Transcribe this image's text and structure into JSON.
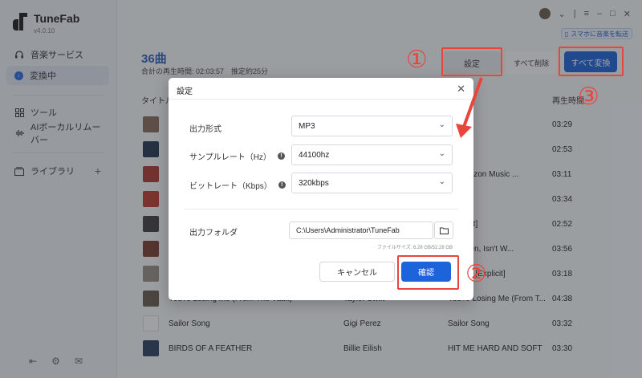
{
  "app": {
    "name": "TuneFab",
    "version": "v4.0.10"
  },
  "sidebar": {
    "items": [
      {
        "label": "音楽サービス",
        "icon": "headphones-icon"
      },
      {
        "label": "変換中",
        "icon": "download-icon"
      },
      {
        "label": "ツール",
        "icon": "grid-icon"
      },
      {
        "label": "AIボーカルリムーバー",
        "icon": "waveform-icon"
      },
      {
        "label": "ライブラリ",
        "icon": "library-icon"
      }
    ]
  },
  "topbar": {
    "transfer_label": "スマホに音楽を転送"
  },
  "main": {
    "song_count": "36曲",
    "meta": "合計の再生時間: 02:03:57　推定約25分",
    "settings_button": "設定",
    "delete_all_button": "すべて削除",
    "convert_all_button": "すべて変換",
    "columns": {
      "title": "タイトル",
      "duration": "再生時間"
    },
    "rows": [
      {
        "title": "",
        "artist": "",
        "album": "r",
        "duration": "03:29",
        "color": "#8a6a5a"
      },
      {
        "title": "",
        "artist": "",
        "album": "ing",
        "duration": "02:53",
        "color": "#23354f"
      },
      {
        "title": "",
        "artist": "",
        "album": "e (Amazon Music ...",
        "duration": "03:11",
        "color": "#b03a2e"
      },
      {
        "title": "",
        "artist": "",
        "album": "",
        "duration": "03:34",
        "color": "#c0392b"
      },
      {
        "title": "",
        "artist": "",
        "album": "[Explicit]",
        "duration": "02:52",
        "color": "#3d3d3d"
      },
      {
        "title": "",
        "artist": "",
        "album": "'ve Been, Isn't W...",
        "duration": "03:56",
        "color": "#7a3b2e"
      },
      {
        "title": "",
        "artist": "",
        "album": "Broken [Explicit]",
        "duration": "03:18",
        "color": "#9a8f86"
      },
      {
        "title": "You're Losing Me (From The Vault)",
        "artist": "Taylor Swift",
        "album": "You're Losing Me (From T...",
        "duration": "04:38",
        "color": "#6a5a4a"
      },
      {
        "title": "Sailor Song",
        "artist": "Gigi Perez",
        "album": "Sailor Song",
        "duration": "03:32",
        "color": "#ffffff"
      },
      {
        "title": "BIRDS OF A FEATHER",
        "artist": "Billie Eilish",
        "album": "HIT ME HARD AND SOFT",
        "duration": "03:30",
        "color": "#2a3e5c"
      }
    ]
  },
  "dialog": {
    "title": "設定",
    "output_format_label": "出力形式",
    "output_format_value": "MP3",
    "sample_rate_label": "サンプルレート（Hz）",
    "sample_rate_value": "44100hz",
    "bitrate_label": "ビットレート（Kbps）",
    "bitrate_value": "320kbps",
    "output_folder_label": "出力フォルダ",
    "output_folder_value": "C:\\Users\\Administrator\\TuneFab",
    "file_size": "ファイルサイズ: 6.29 GB/52.28 GB",
    "cancel_button": "キャンセル",
    "confirm_button": "確認"
  },
  "annotations": {
    "step1": "①",
    "step2": "②",
    "step3": "③",
    "accent_color": "#e8453c"
  }
}
